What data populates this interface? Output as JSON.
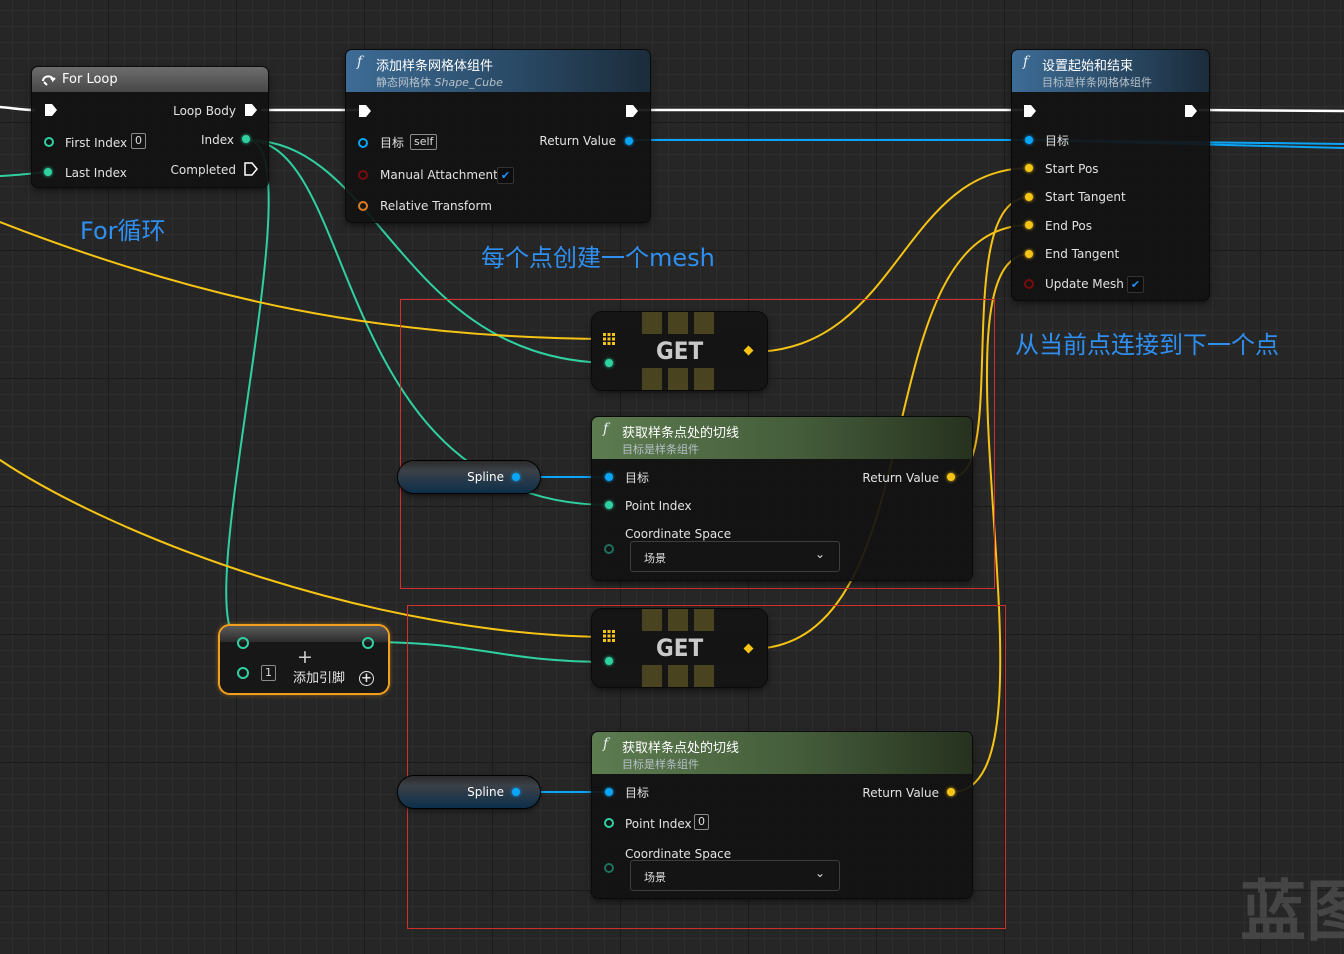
{
  "annotations": {
    "for_loop": "For循环",
    "create_mesh": "每个点创建一个mesh",
    "connect_next": "从当前点连接到下一个点"
  },
  "watermark": "蓝图",
  "for_loop_node": {
    "title": "For Loop",
    "loop_body": "Loop Body",
    "first_index": "First Index",
    "first_index_value": "0",
    "index": "Index",
    "last_index": "Last Index",
    "completed": "Completed"
  },
  "add_spline_mesh_node": {
    "title": "添加样条网格体组件",
    "subtitle_prefix": "静态网格体",
    "subtitle_asset": "Shape_Cube",
    "target": "目标",
    "target_value": "self",
    "manual_attachment": "Manual Attachment",
    "relative_transform": "Relative Transform",
    "return_value": "Return Value"
  },
  "set_start_end_node": {
    "title": "设置起始和结束",
    "subtitle": "目标是样条网格体组件",
    "target": "目标",
    "start_pos": "Start Pos",
    "start_tangent": "Start Tangent",
    "end_pos": "End Pos",
    "end_tangent": "End Tangent",
    "update_mesh": "Update Mesh"
  },
  "get_nodes": [
    {
      "label": "GET"
    },
    {
      "label": "GET"
    }
  ],
  "tangent_nodes": [
    {
      "title": "获取样条点处的切线",
      "subtitle": "目标是样条组件",
      "target": "目标",
      "point_index": "Point Index",
      "point_index_value": "",
      "coordinate_space": "Coordinate Space",
      "coordinate_space_value": "场景",
      "return_value": "Return Value"
    },
    {
      "title": "获取样条点处的切线",
      "subtitle": "目标是样条组件",
      "target": "目标",
      "point_index": "Point Index",
      "point_index_value": "0",
      "coordinate_space": "Coordinate Space",
      "coordinate_space_value": "场景",
      "return_value": "Return Value"
    }
  ],
  "spline_vars": [
    {
      "label": "Spline"
    },
    {
      "label": "Spline"
    }
  ],
  "add_node": {
    "plus": "+",
    "second_value": "1",
    "add_pin": "添加引脚"
  },
  "colors": {
    "exec": "#ffffff",
    "object": "#0aa5f7",
    "integer": "#2fd1a0",
    "vector": "#f6c414",
    "annotation": "#2f8ff0",
    "comment_box": "#d0312d"
  },
  "icons": {
    "for_loop": "loop-icon",
    "function": "function-icon",
    "checkbox": "checkmark-icon",
    "dropdown": "chevron-down-icon",
    "array": "array-grid-icon",
    "add": "plus-circle-icon"
  }
}
